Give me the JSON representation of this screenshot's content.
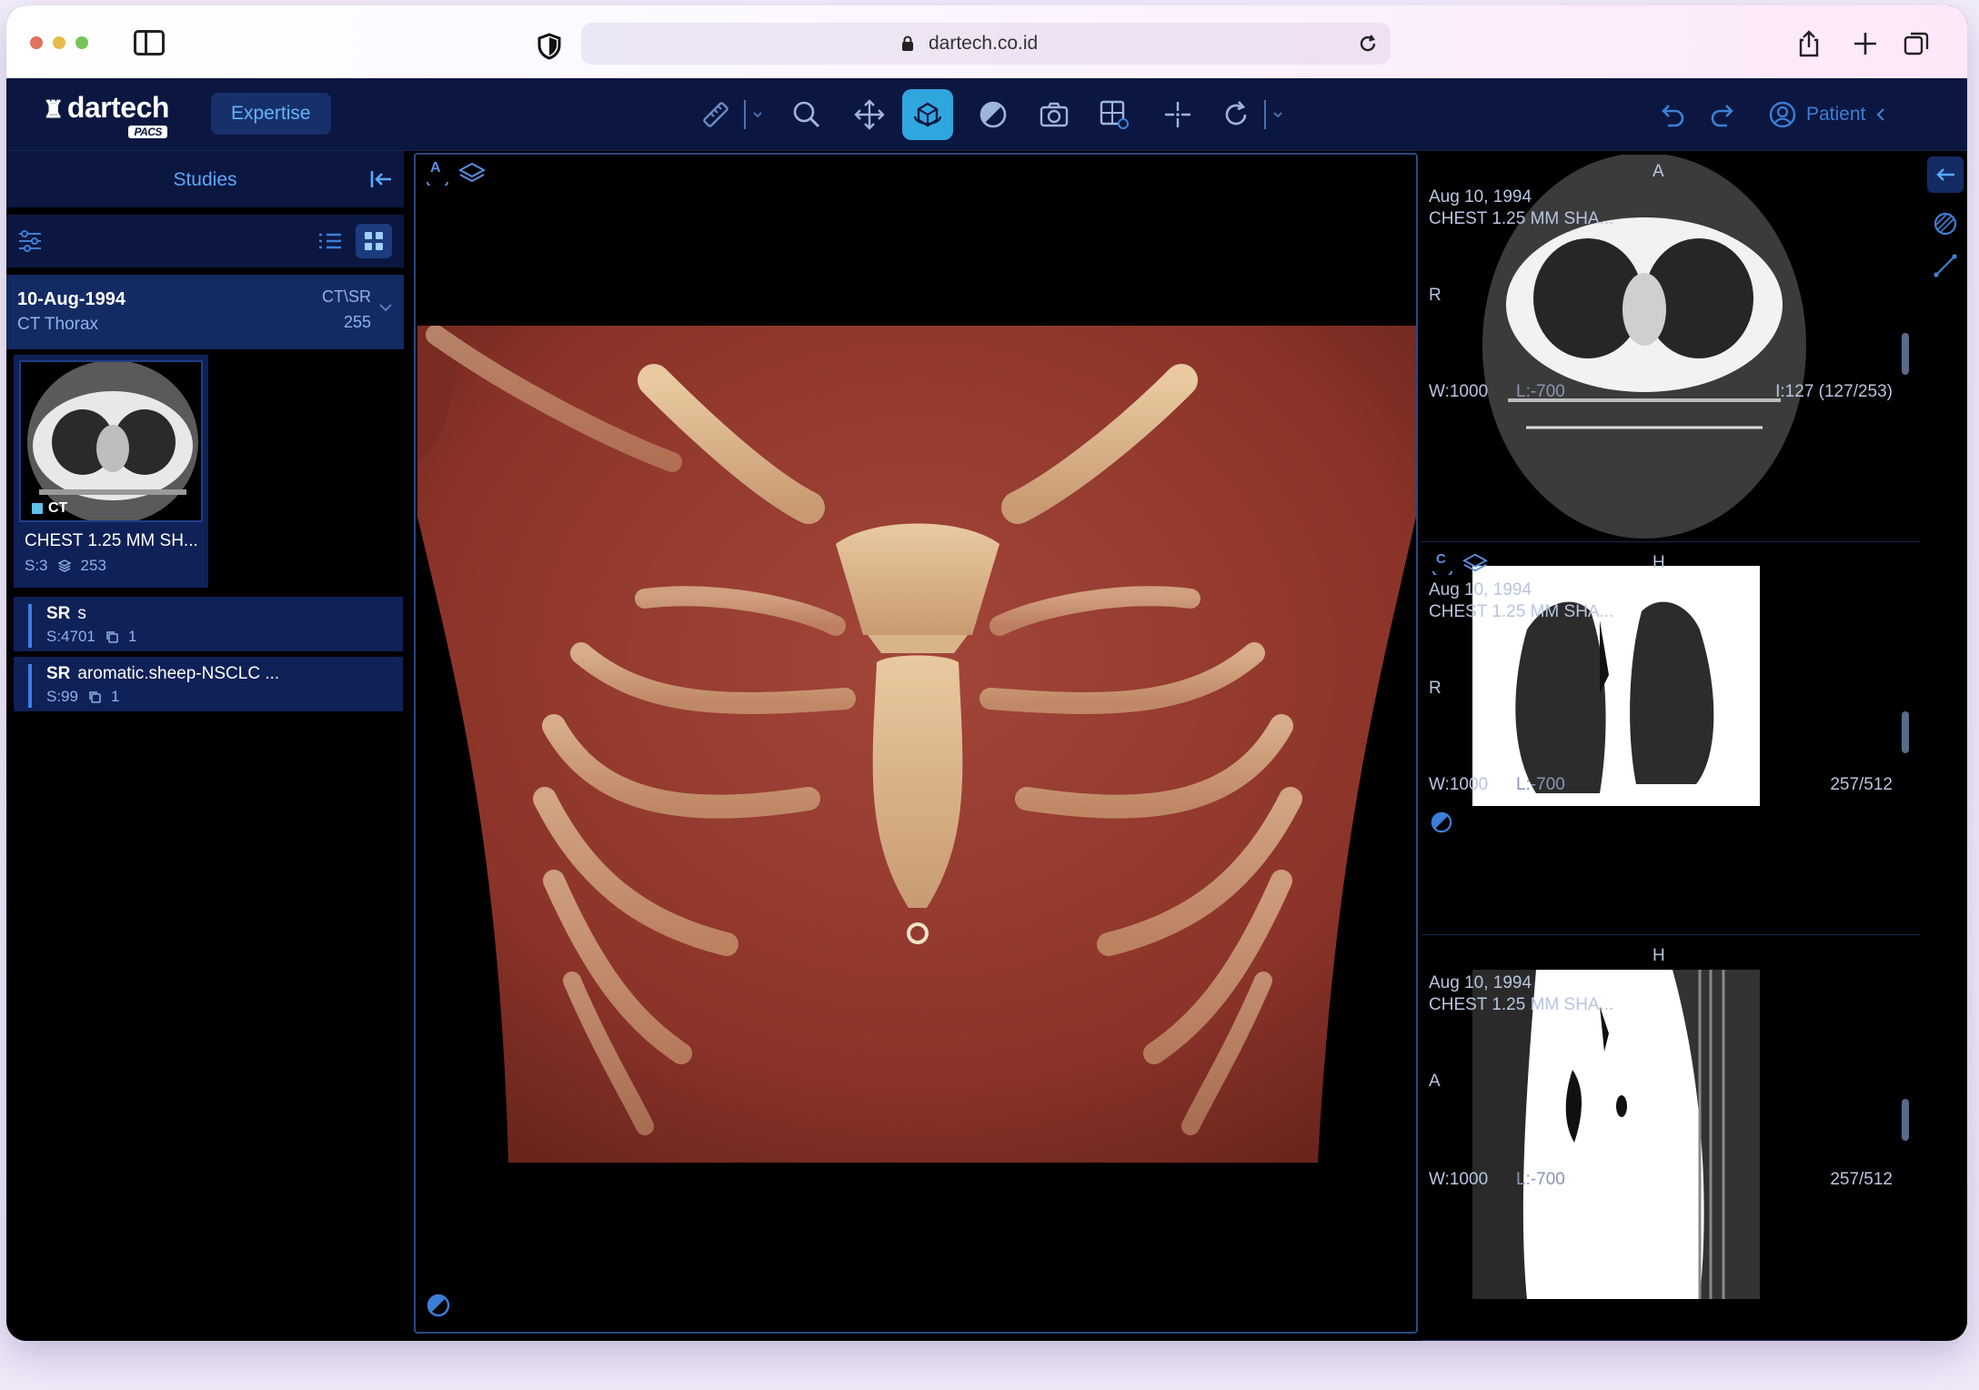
{
  "browser": {
    "url": "dartech.co.id"
  },
  "app": {
    "logo": "dartech",
    "logo_badge": "PACS",
    "mode_button": "Expertise",
    "patient_label": "Patient"
  },
  "studies_panel": {
    "title": "Studies",
    "study": {
      "date": "10-Aug-1994",
      "description": "CT Thorax",
      "modality": "CT\\SR",
      "count": "255"
    },
    "series": [
      {
        "modality": "CT",
        "name": "CHEST 1.25 MM SH...",
        "series_no": "S:3",
        "instances": "253"
      }
    ],
    "sr_items": [
      {
        "modality": "SR",
        "name": "s",
        "series_no": "S:4701",
        "instances": "1"
      },
      {
        "modality": "SR",
        "name": "aromatic.sheep-NSCLC ...",
        "series_no": "S:99",
        "instances": "1"
      }
    ]
  },
  "main_viewport": {
    "orientation_label": "A"
  },
  "viewports": [
    {
      "top_marker": "A",
      "left_marker": "R",
      "date": "Aug 10, 1994",
      "series": "CHEST 1.25 MM SHA...",
      "window": "W:1000",
      "level": "L:-700",
      "slice": "I:127 (127/253)"
    },
    {
      "top_marker": "H",
      "left_marker": "R",
      "corner_label": "C",
      "date": "Aug 10, 1994",
      "series": "CHEST 1.25 MM SHA...",
      "window": "W:1000",
      "level": "L:-700",
      "slice": "257/512"
    },
    {
      "top_marker": "H",
      "left_marker": "A",
      "date": "Aug 10, 1994",
      "series": "CHEST 1.25 MM SHA...",
      "window": "W:1000",
      "level": "L:-700",
      "slice": "257/512"
    }
  ],
  "colors": {
    "header_bg": "#0b1740",
    "accent": "#2fa6de",
    "active_study_bg": "#132a63",
    "link_blue": "#5aa9ff"
  }
}
